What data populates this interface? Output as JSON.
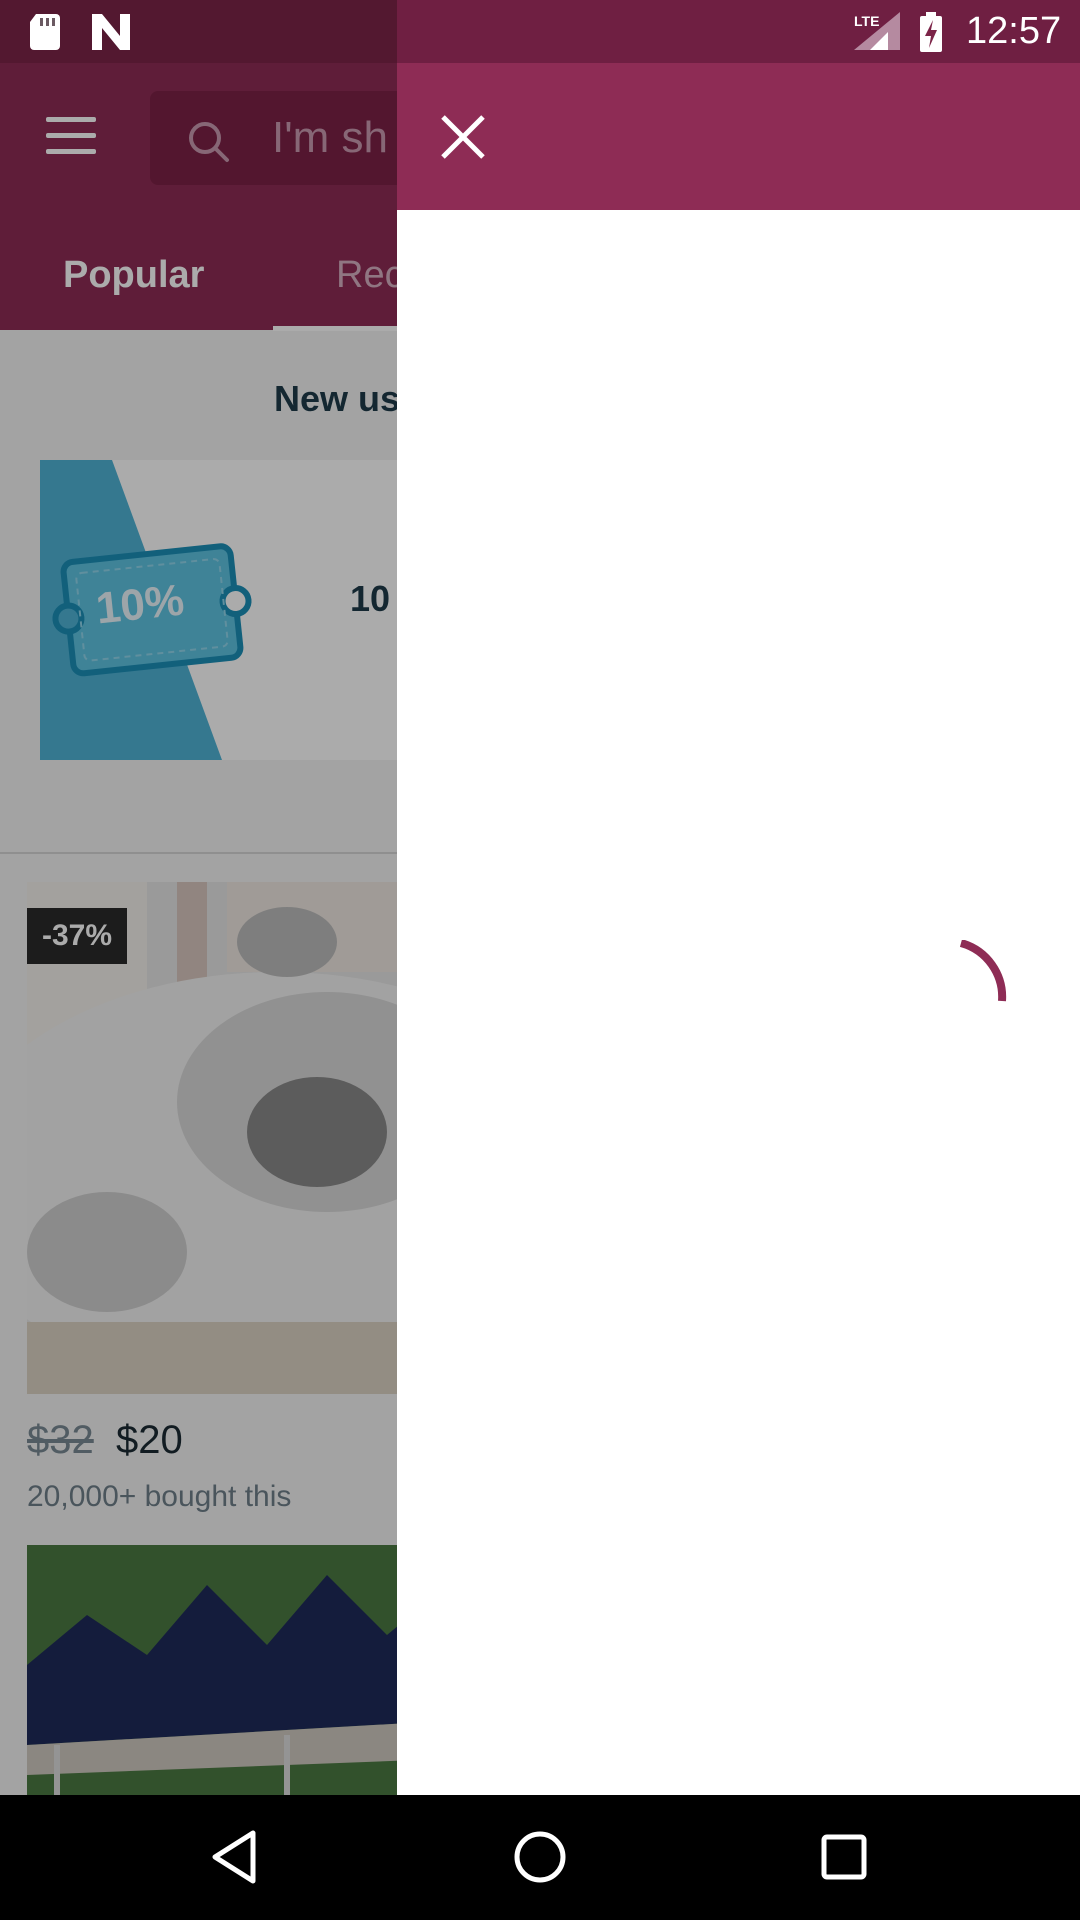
{
  "status_bar": {
    "time": "12:57",
    "network": "LTE",
    "icons": [
      "sd-card-icon",
      "notification-n-icon",
      "lte-signal-icon",
      "battery-charging-icon"
    ]
  },
  "toolbar": {
    "search_placeholder": "I'm sh"
  },
  "tabs": [
    {
      "label": "Popular"
    },
    {
      "label": "Rec"
    }
  ],
  "promo": {
    "title": "New us",
    "ticket_text": "10%",
    "description": "10"
  },
  "product": {
    "discount_badge": "-37%",
    "price_old": "$32",
    "price_new": "$20",
    "bought": "20,000+ bought this"
  },
  "colors": {
    "brand": "#8e2c55",
    "brand_dark": "#6f1f42",
    "spinner": "#8e2c55"
  }
}
